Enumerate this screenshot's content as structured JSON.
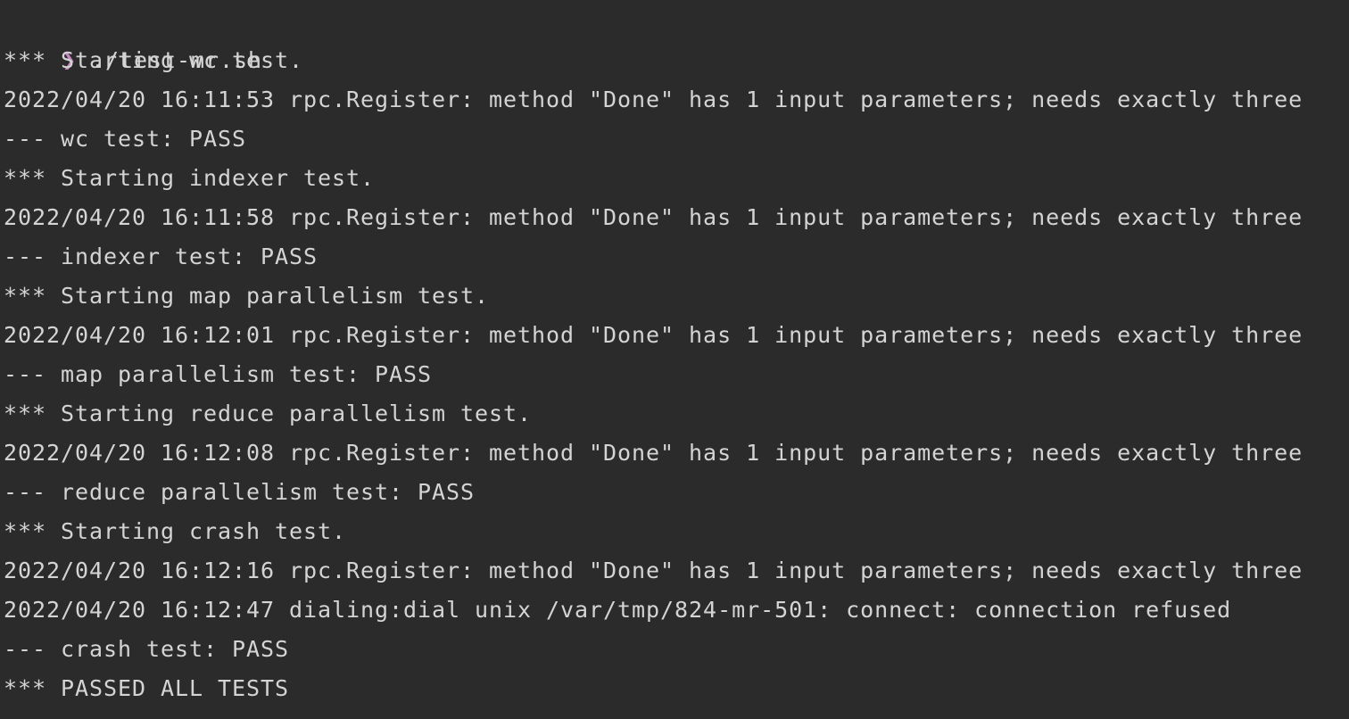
{
  "colors": {
    "background": "#2b2b2c",
    "text": "#d4d4d4",
    "prompt": "#c586c0"
  },
  "prompt": {
    "symbol": "❯",
    "command": "./test-mr.sh"
  },
  "output": [
    "*** Starting wc test.",
    "2022/04/20 16:11:53 rpc.Register: method \"Done\" has 1 input parameters; needs exactly three",
    "--- wc test: PASS",
    "*** Starting indexer test.",
    "2022/04/20 16:11:58 rpc.Register: method \"Done\" has 1 input parameters; needs exactly three",
    "--- indexer test: PASS",
    "*** Starting map parallelism test.",
    "2022/04/20 16:12:01 rpc.Register: method \"Done\" has 1 input parameters; needs exactly three",
    "--- map parallelism test: PASS",
    "*** Starting reduce parallelism test.",
    "2022/04/20 16:12:08 rpc.Register: method \"Done\" has 1 input parameters; needs exactly three",
    "--- reduce parallelism test: PASS",
    "*** Starting crash test.",
    "2022/04/20 16:12:16 rpc.Register: method \"Done\" has 1 input parameters; needs exactly three",
    "2022/04/20 16:12:47 dialing:dial unix /var/tmp/824-mr-501: connect: connection refused",
    "--- crash test: PASS",
    "*** PASSED ALL TESTS"
  ]
}
